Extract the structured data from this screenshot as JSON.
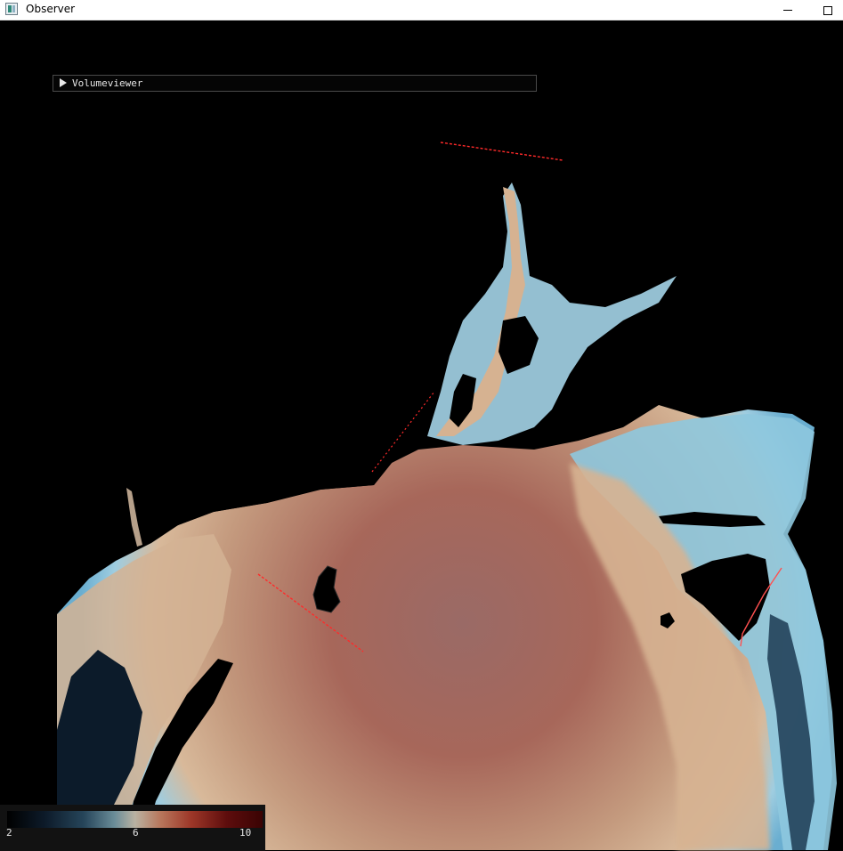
{
  "window": {
    "title": "Observer",
    "icon": "app-window-icon",
    "controls": [
      "minimize-icon",
      "maximize-icon"
    ]
  },
  "panel": {
    "label": "Volumeviewer",
    "collapsed": true
  },
  "colorbar": {
    "min_label": "2",
    "mid_label": "6",
    "max_label": "10"
  },
  "colors": {
    "background": "#000000",
    "land": "#000000",
    "deep_water": "#a86a5c",
    "shallow_water": "#8ec8de",
    "transect": "#ff2020"
  }
}
